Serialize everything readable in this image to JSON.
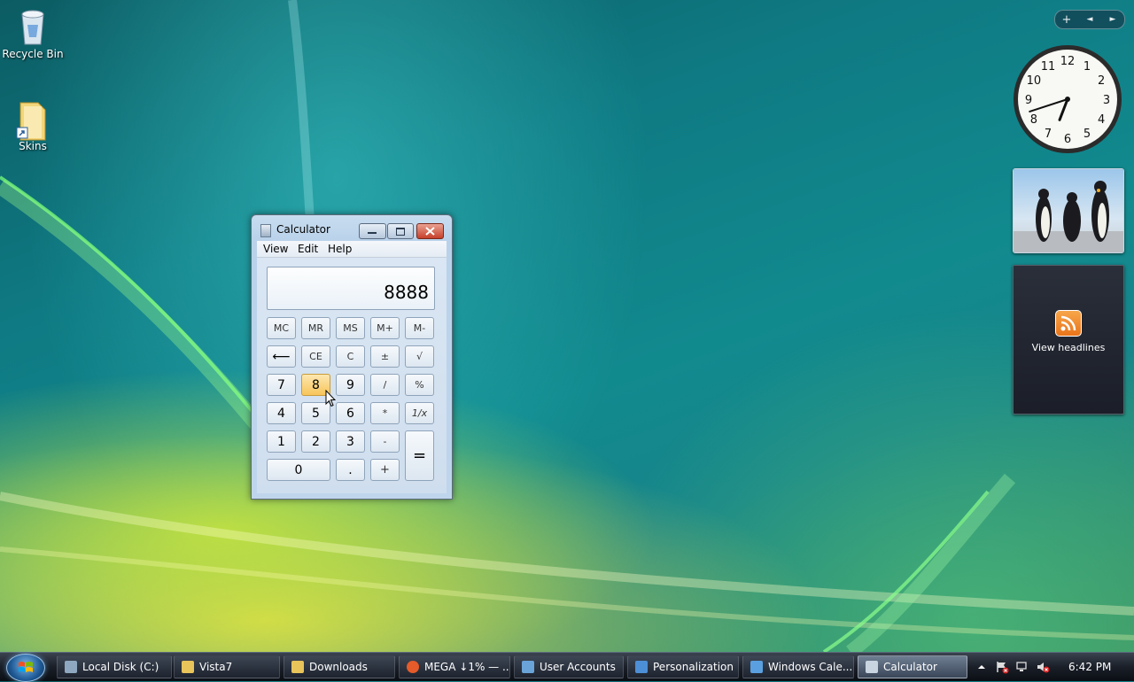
{
  "desktop": {
    "icons": [
      {
        "label": "Recycle Bin"
      },
      {
        "label": "Skins"
      }
    ]
  },
  "gadgets": {
    "sidebar_controls": {
      "add": "+",
      "prev": "◄",
      "next": "►"
    },
    "clock": {
      "numerals": [
        "12",
        "1",
        "2",
        "3",
        "4",
        "5",
        "6",
        "7",
        "8",
        "9",
        "10",
        "11"
      ],
      "time": "6:42"
    },
    "feed": {
      "label": "View headlines"
    }
  },
  "calculator": {
    "title": "Calculator",
    "menus": [
      "View",
      "Edit",
      "Help"
    ],
    "display": "8888",
    "keys": {
      "mc": "MC",
      "mr": "MR",
      "ms": "MS",
      "mplus": "M+",
      "mminus": "M-",
      "back": "⟵",
      "ce": "CE",
      "c": "C",
      "plusminus": "±",
      "sqrt": "√",
      "n7": "7",
      "n8": "8",
      "n9": "9",
      "div": "/",
      "pct": "%",
      "n4": "4",
      "n5": "5",
      "n6": "6",
      "mul": "*",
      "recip": "1/x",
      "n1": "1",
      "n2": "2",
      "n3": "3",
      "sub": "-",
      "eq": "=",
      "n0": "0",
      "dot": ".",
      "add": "+"
    },
    "pressed_key": "8"
  },
  "taskbar": {
    "items": [
      {
        "label": "Local Disk (C:)",
        "icon": "drive-icon",
        "color": "#8fa8c0"
      },
      {
        "label": "Vista7",
        "icon": "folder-icon",
        "color": "#e8c45a"
      },
      {
        "label": "Downloads",
        "icon": "folder-icon",
        "color": "#e8c45a"
      },
      {
        "label": "MEGA ↓1% — ...",
        "icon": "firefox-icon",
        "color": "#e55b2a"
      },
      {
        "label": "User Accounts",
        "icon": "users-icon",
        "color": "#6aa3d8"
      },
      {
        "label": "Personalization",
        "icon": "personalization-icon",
        "color": "#4d8fd6"
      },
      {
        "label": "Windows Cale...",
        "icon": "calendar-icon",
        "color": "#5aa0e0"
      },
      {
        "label": "Calculator",
        "icon": "calculator-icon",
        "color": "#c8d4e0"
      }
    ],
    "clock": "6:42 PM"
  }
}
